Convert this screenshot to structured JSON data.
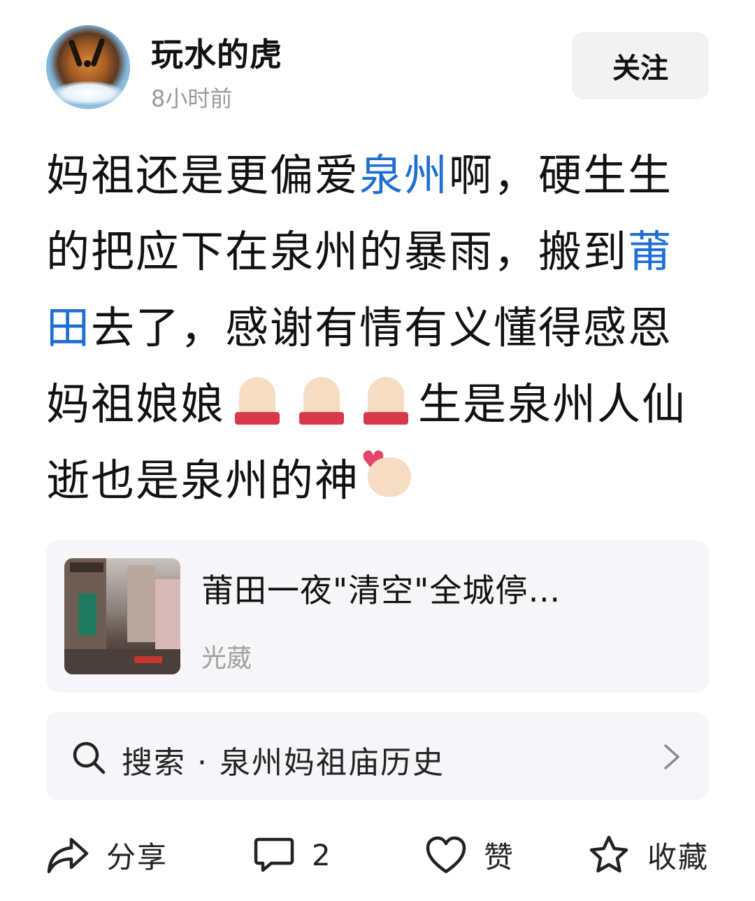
{
  "post": {
    "author": "玩水的虎",
    "timestamp": "8小时前",
    "follow_label": "关注",
    "body": {
      "text_1": "妈祖还是更偏爱",
      "link_1": "泉州",
      "text_2": "啊，硬生生的把应下在泉州的暴雨，搬到",
      "link_2": "莆田",
      "text_3": "去了，感谢有情有义懂得感恩妈祖娘娘",
      "text_4": "生是泉州人仙逝也是泉州的神"
    }
  },
  "link_card": {
    "title": "莆田一夜\"清空\"全城停…",
    "source": "光葳"
  },
  "search": {
    "label": "搜索 · 泉州妈祖庙历史"
  },
  "actions": {
    "share_label": "分享",
    "comment_count": "2",
    "like_label": "赞",
    "favorite_label": "收藏"
  },
  "icons": [
    "tiger-avatar",
    "pray-emoji",
    "finger-heart-emoji",
    "search-icon",
    "chevron-right-icon",
    "share-icon",
    "comment-icon",
    "heart-icon",
    "star-icon"
  ],
  "colors": {
    "link": "#1f6fd1",
    "muted": "#9a9a9a",
    "card_bg": "#f6f6f8"
  }
}
